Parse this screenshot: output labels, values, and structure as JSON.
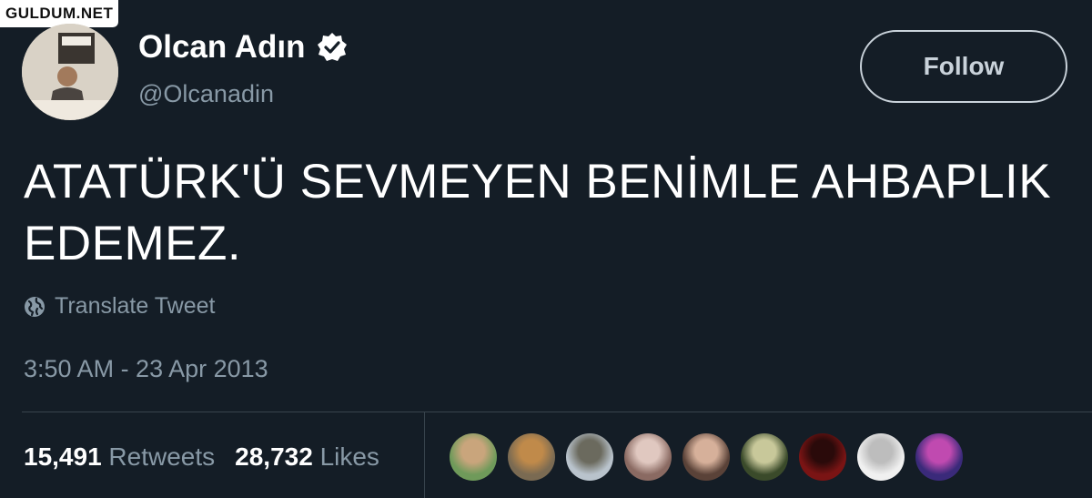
{
  "watermark": "GULDUM.NET",
  "user": {
    "name": "Olcan Adın",
    "handle": "@Olcanadin",
    "verified_icon": "verified-badge-icon"
  },
  "follow_label": "Follow",
  "tweet": {
    "text": "ATATÜRK'Ü SEVMEYEN BENİMLE AHBAPLIK EDEMEZ.",
    "translate_label": "Translate Tweet",
    "translate_icon": "globe-icon",
    "timestamp": "3:50 AM - 23 Apr 2013"
  },
  "stats": {
    "retweets_count": "15,491",
    "retweets_label": "Retweets",
    "likes_count": "28,732",
    "likes_label": "Likes"
  },
  "colors": {
    "background": "#141d26",
    "secondary_text": "#8899a6",
    "divider": "#38444d"
  },
  "likers": [
    {
      "colors": [
        "#6f9a5a",
        "#c9a57c"
      ]
    },
    {
      "colors": [
        "#7a6a52",
        "#c08a4a"
      ]
    },
    {
      "colors": [
        "#b9c3cc",
        "#6b6a5e"
      ]
    },
    {
      "colors": [
        "#8a6a62",
        "#e0c8c0"
      ]
    },
    {
      "colors": [
        "#5a4238",
        "#d6b09a"
      ]
    },
    {
      "colors": [
        "#3a4a2a",
        "#c8c89a"
      ]
    },
    {
      "colors": [
        "#7a1414",
        "#2a0a0a"
      ]
    },
    {
      "colors": [
        "#f0f0f0",
        "#bdbdbd"
      ]
    },
    {
      "colors": [
        "#3a2a7a",
        "#c04ab0"
      ]
    }
  ]
}
